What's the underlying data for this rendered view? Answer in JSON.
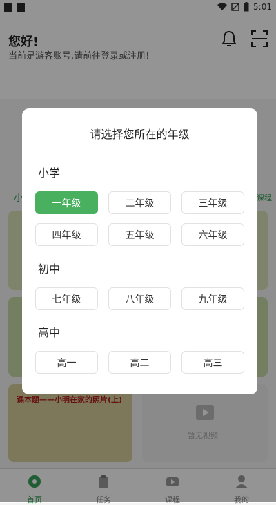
{
  "status": {
    "time": "5:01"
  },
  "header": {
    "greeting": "您好!",
    "subtitle": "当前是游客账号,请前往登录或注册!"
  },
  "background": {
    "section_tab": "小",
    "right_link": "课程",
    "card5_title": "课本题——小明在家的照片(上)",
    "card6_label": "暂无视频"
  },
  "tabs": [
    {
      "label": "首页",
      "icon": "home-icon",
      "active": true
    },
    {
      "label": "任务",
      "icon": "clipboard-icon",
      "active": false
    },
    {
      "label": "课程",
      "icon": "video-icon",
      "active": false
    },
    {
      "label": "我的",
      "icon": "user-icon",
      "active": false
    }
  ],
  "dialog": {
    "title": "请选择您所在的年级",
    "sections": [
      {
        "name": "小学",
        "grades": [
          "一年级",
          "二年级",
          "三年级",
          "四年级",
          "五年级",
          "六年级"
        ]
      },
      {
        "name": "初中",
        "grades": [
          "七年级",
          "八年级",
          "九年级"
        ]
      },
      {
        "name": "高中",
        "grades": [
          "高一",
          "高二",
          "高三"
        ]
      }
    ],
    "selected": "一年级"
  },
  "colors": {
    "accent": "#48b05f",
    "overlay": "rgba(0,0,0,0.42)"
  }
}
